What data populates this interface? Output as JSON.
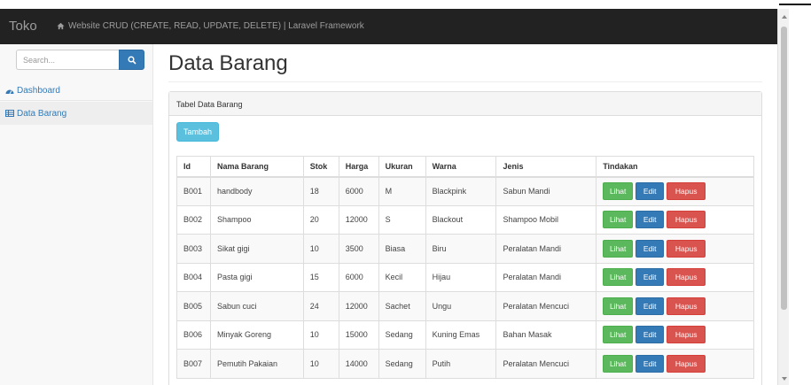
{
  "navbar": {
    "brand": "Toko",
    "link": "Website CRUD (CREATE, READ, UPDATE, DELETE) | Laravel Framework"
  },
  "sidebar": {
    "search_placeholder": "Search...",
    "items": [
      {
        "label": "Dashboard",
        "icon": "dashboard-icon"
      },
      {
        "label": "Data Barang",
        "icon": "table-icon"
      }
    ]
  },
  "main": {
    "title": "Data Barang",
    "panel_title": "Tabel Data Barang",
    "add_label": "Tambah"
  },
  "table": {
    "headers": [
      "Id",
      "Nama Barang",
      "Stok",
      "Harga",
      "Ukuran",
      "Warna",
      "Jenis",
      "Tindakan"
    ],
    "rows": [
      [
        "B001",
        "handbody",
        "18",
        "6000",
        "M",
        "Blackpink",
        "Sabun Mandi"
      ],
      [
        "B002",
        "Shampoo",
        "20",
        "12000",
        "S",
        "Blackout",
        "Shampoo Mobil"
      ],
      [
        "B003",
        "Sikat gigi",
        "10",
        "3500",
        "Biasa",
        "Biru",
        "Peralatan Mandi"
      ],
      [
        "B004",
        "Pasta gigi",
        "15",
        "6000",
        "Kecil",
        "Hijau",
        "Peralatan Mandi"
      ],
      [
        "B005",
        "Sabun cuci",
        "24",
        "12000",
        "Sachet",
        "Ungu",
        "Peralatan Mencuci"
      ],
      [
        "B006",
        "Minyak Goreng",
        "10",
        "15000",
        "Sedang",
        "Kuning Emas",
        "Bahan Masak"
      ],
      [
        "B007",
        "Pemutih Pakaian",
        "10",
        "14000",
        "Sedang",
        "Putih",
        "Peralatan Mencuci"
      ]
    ],
    "actions": {
      "view": "Lihat",
      "edit": "Edit",
      "delete": "Hapus"
    }
  },
  "colors": {
    "navbar": "#222222",
    "primary": "#337ab7",
    "success": "#5cb85c",
    "danger": "#d9534f",
    "info": "#5bc0de"
  }
}
